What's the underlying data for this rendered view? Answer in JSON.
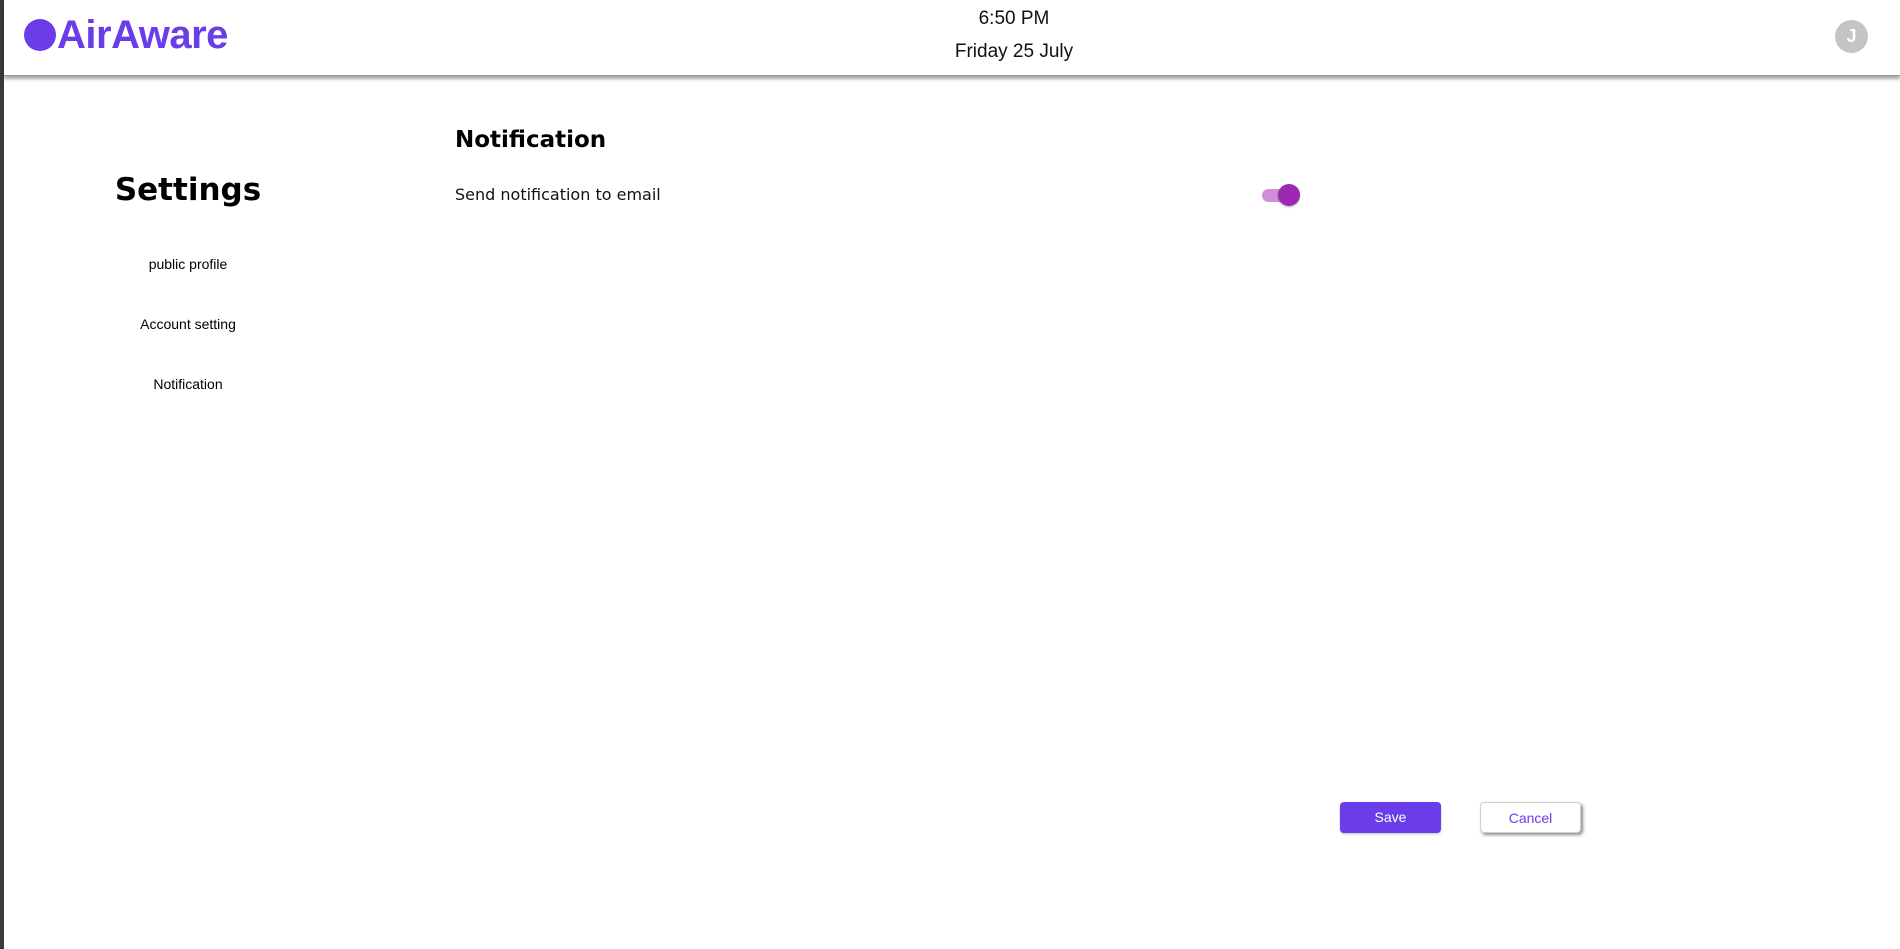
{
  "app": {
    "name": "AirAware",
    "logo_icon": "circle-logo-icon",
    "brand_color": "#6a3de8"
  },
  "header": {
    "time": "6:50 PM",
    "date": "Friday 25 July",
    "avatar_initial": "J"
  },
  "sidebar": {
    "title": "Settings",
    "items": [
      {
        "label": "public profile"
      },
      {
        "label": "Account setting"
      },
      {
        "label": "Notification"
      }
    ]
  },
  "main": {
    "section_title": "Notification",
    "settings": [
      {
        "label": "Send notification to email",
        "enabled": true
      }
    ],
    "toggle_color": "#9c27b0"
  },
  "actions": {
    "save_label": "Save",
    "cancel_label": "Cancel"
  }
}
